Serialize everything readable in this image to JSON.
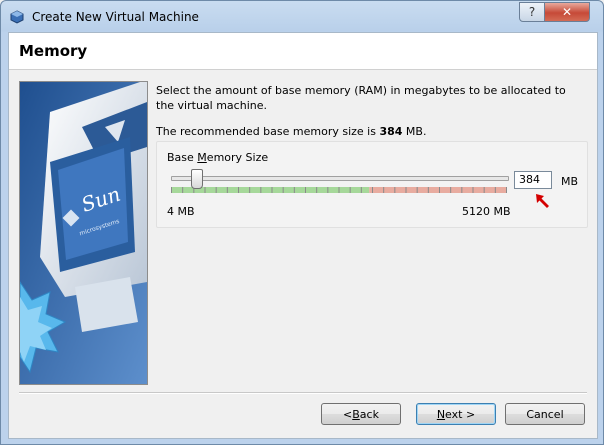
{
  "window": {
    "title": "Create New Virtual Machine",
    "help_label": "?",
    "close_label": "✕"
  },
  "page": {
    "title": "Memory",
    "description": "Select the amount of base memory (RAM) in megabytes to be allocated to the virtual machine.",
    "recommended_prefix": "The recommended base memory size is ",
    "recommended_value": "384",
    "recommended_suffix": " MB."
  },
  "memory": {
    "group_label_pre": "Base ",
    "group_label_accel": "M",
    "group_label_post": "emory Size",
    "value": "384",
    "unit": "MB",
    "min_label": "4 MB",
    "max_label": "5120 MB",
    "slider_fraction": 0.074,
    "recommended_range_fraction": 0.59
  },
  "graphic": {
    "brand": "Sun",
    "brand_sub": "microsystems"
  },
  "buttons": {
    "back_accel": "B",
    "back_pre": "< ",
    "back_post": "ack",
    "next_accel": "N",
    "next_post": "ext >",
    "cancel": "Cancel"
  },
  "colors": {
    "green_zone": "#a6d89a",
    "red_zone": "#e8aca0",
    "arrow": "#d40000"
  }
}
